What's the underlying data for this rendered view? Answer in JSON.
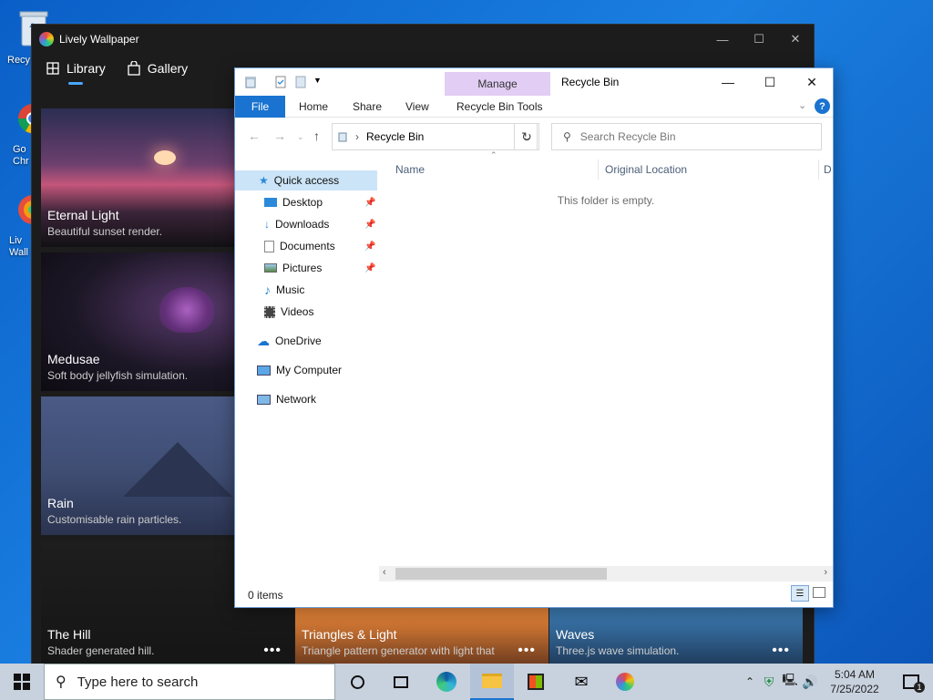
{
  "desktop": {
    "icons": [
      {
        "label": "Recy"
      },
      {
        "label": "Go Chr"
      },
      {
        "label": "Liv Wall"
      }
    ]
  },
  "lively": {
    "title": "Lively Wallpaper",
    "nav": [
      {
        "label": "Library"
      },
      {
        "label": "Gallery"
      }
    ],
    "cards": [
      {
        "title": "Eternal Light",
        "desc": "Beautiful sunset render."
      },
      {
        "title": "Medusae",
        "desc": "Soft body jellyfish simulation."
      },
      {
        "title": "Rain",
        "desc": "Customisable rain particles."
      },
      {
        "title": "The Hill",
        "desc": "Shader generated hill."
      },
      {
        "title": "Triangles & Light",
        "desc": "Triangle pattern generator with light that"
      },
      {
        "title": "Waves",
        "desc": "Three.js wave simulation."
      }
    ],
    "more_glyph": "•••"
  },
  "explorer": {
    "manage_label": "Manage",
    "window_title": "Recycle Bin",
    "ribbon_tabs": [
      "File",
      "Home",
      "Share",
      "View",
      "Recycle Bin Tools"
    ],
    "address": "Recycle Bin",
    "search_placeholder": "Search Recycle Bin",
    "nav_items": [
      {
        "label": "Quick access"
      },
      {
        "label": "Desktop"
      },
      {
        "label": "Downloads"
      },
      {
        "label": "Documents"
      },
      {
        "label": "Pictures"
      },
      {
        "label": "Music"
      },
      {
        "label": "Videos"
      },
      {
        "label": "OneDrive"
      },
      {
        "label": "My Computer"
      },
      {
        "label": "Network"
      }
    ],
    "columns": [
      "Name",
      "Original Location",
      "D"
    ],
    "empty_message": "This folder is empty.",
    "status": "0 items"
  },
  "taskbar": {
    "search_placeholder": "Type here to search",
    "time": "5:04 AM",
    "date": "7/25/2022",
    "notification_count": "1"
  }
}
